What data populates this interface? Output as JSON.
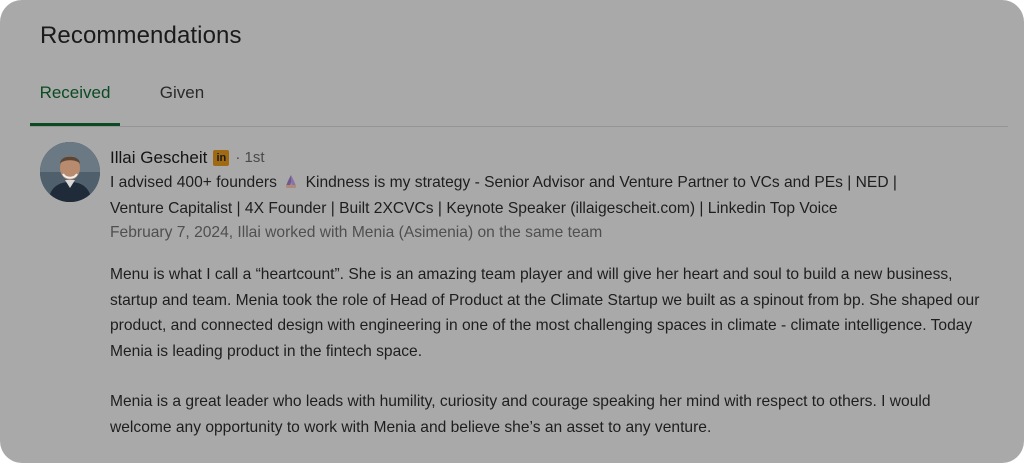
{
  "section": {
    "title": "Recommendations"
  },
  "tabs": [
    {
      "label": "Received",
      "active": true
    },
    {
      "label": "Given",
      "active": false
    }
  ],
  "recommendation": {
    "name": "Illai Gescheit",
    "badge_icon": "linkedin-icon",
    "badge_text": "in",
    "degree": "· 1st",
    "headline_part1": "I advised 400+ founders",
    "headline_emoji": "folded-hands-icon",
    "headline_line1_rest": "Kindness is my strategy - Senior Advisor and Venture Partner to VCs and PEs | NED |",
    "headline_line2": "Venture Capitalist | 4X Founder | Built 2XCVCs | Keynote Speaker (illaigescheit.com) | Linkedin Top Voice",
    "context": "February 7, 2024, Illai worked with Menia (Asimenia) on the same team",
    "paragraph1": "Menu is what I call a “heartcount”. She is an amazing team player and will give her heart and soul to build a new business, startup and team. Menia took the role of Head of Product at the Climate Startup we built as a spinout from bp. She shaped our product, and connected design with engineering in one of the most challenging spaces in climate - climate intelligence. Today Menia is leading product in the fintech space.",
    "paragraph2": "Menia is a great leader who leads with humility, curiosity and courage speaking her mind with respect to others. I would welcome any opportunity to work with Menia and believe she’s an asset to any venture."
  },
  "colors": {
    "overlay_bg": "#a9a9a9",
    "active_tab": "#0c4a23",
    "badge": "#a06a14"
  }
}
